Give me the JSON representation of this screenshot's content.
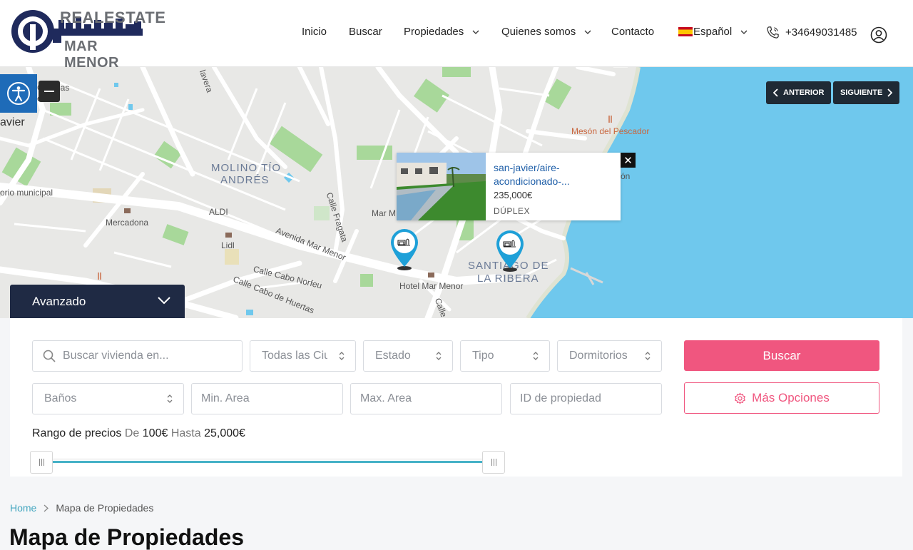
{
  "brand": {
    "line1": "REALESTATE",
    "line2": "MAR MENOR"
  },
  "nav": {
    "inicio": "Inicio",
    "buscar": "Buscar",
    "propiedades": "Propiedades",
    "quienes": "Quienes somos",
    "contacto": "Contacto",
    "idioma": "Español",
    "phone": "+34649031485"
  },
  "map": {
    "labels": {
      "overeas": "Overeas",
      "erado": "erado",
      "avier": "avier",
      "rio": "orio municipal",
      "molino1": "MOLINO TÍO",
      "molino2": "ANDRÉS",
      "aldi": "ALDI",
      "mercadona": "Mercadona",
      "lidl": "Lidl",
      "calle_fragata": "Calle Fragata",
      "avenida": "Avenida Mar Menor",
      "cabo_norfeu": "Calle Cabo Norfeu",
      "cabo_huertas": "Calle Cabo de Huertas",
      "hotel": "Hotel Mar Menor",
      "santiago1": "SANTIAGO DE",
      "santiago2": "LA RIBERA",
      "meson": "Mesón del Pescador",
      "mar_m": "Mar M",
      "cale": "Calle",
      "lavera": "lavera",
      "on": "ón"
    },
    "prev": "ANTERIOR",
    "next": "SIGUIENTE",
    "popup": {
      "title": "san-javier/aire-acondicionado-...",
      "price": "235,000€",
      "type": "DÚPLEX",
      "close": "✕"
    }
  },
  "search": {
    "tab": "Avanzado",
    "keyword_placeholder": "Buscar vivienda en...",
    "cities": "Todas las Ciudades",
    "estado": "Estado",
    "tipo": "Tipo",
    "dormitorios": "Dormitorios",
    "banos": "Baños",
    "min_area": "Min. Area",
    "max_area": "Max. Area",
    "id_prop": "ID de propiedad",
    "buscar": "Buscar",
    "mas_opciones": "Más Opciones",
    "range": {
      "label": "Rango de precios",
      "de": "De",
      "min": "100€",
      "hasta": "Hasta",
      "max": "25,000€"
    }
  },
  "breadcrumb": {
    "home": "Home",
    "current": "Mapa de Propiedades"
  },
  "page_title": "Mapa de Propiedades",
  "colors": {
    "accent": "#f0567f",
    "navy": "#1f2a44",
    "slider": "#45b1c7",
    "water": "#6fc8ed"
  }
}
